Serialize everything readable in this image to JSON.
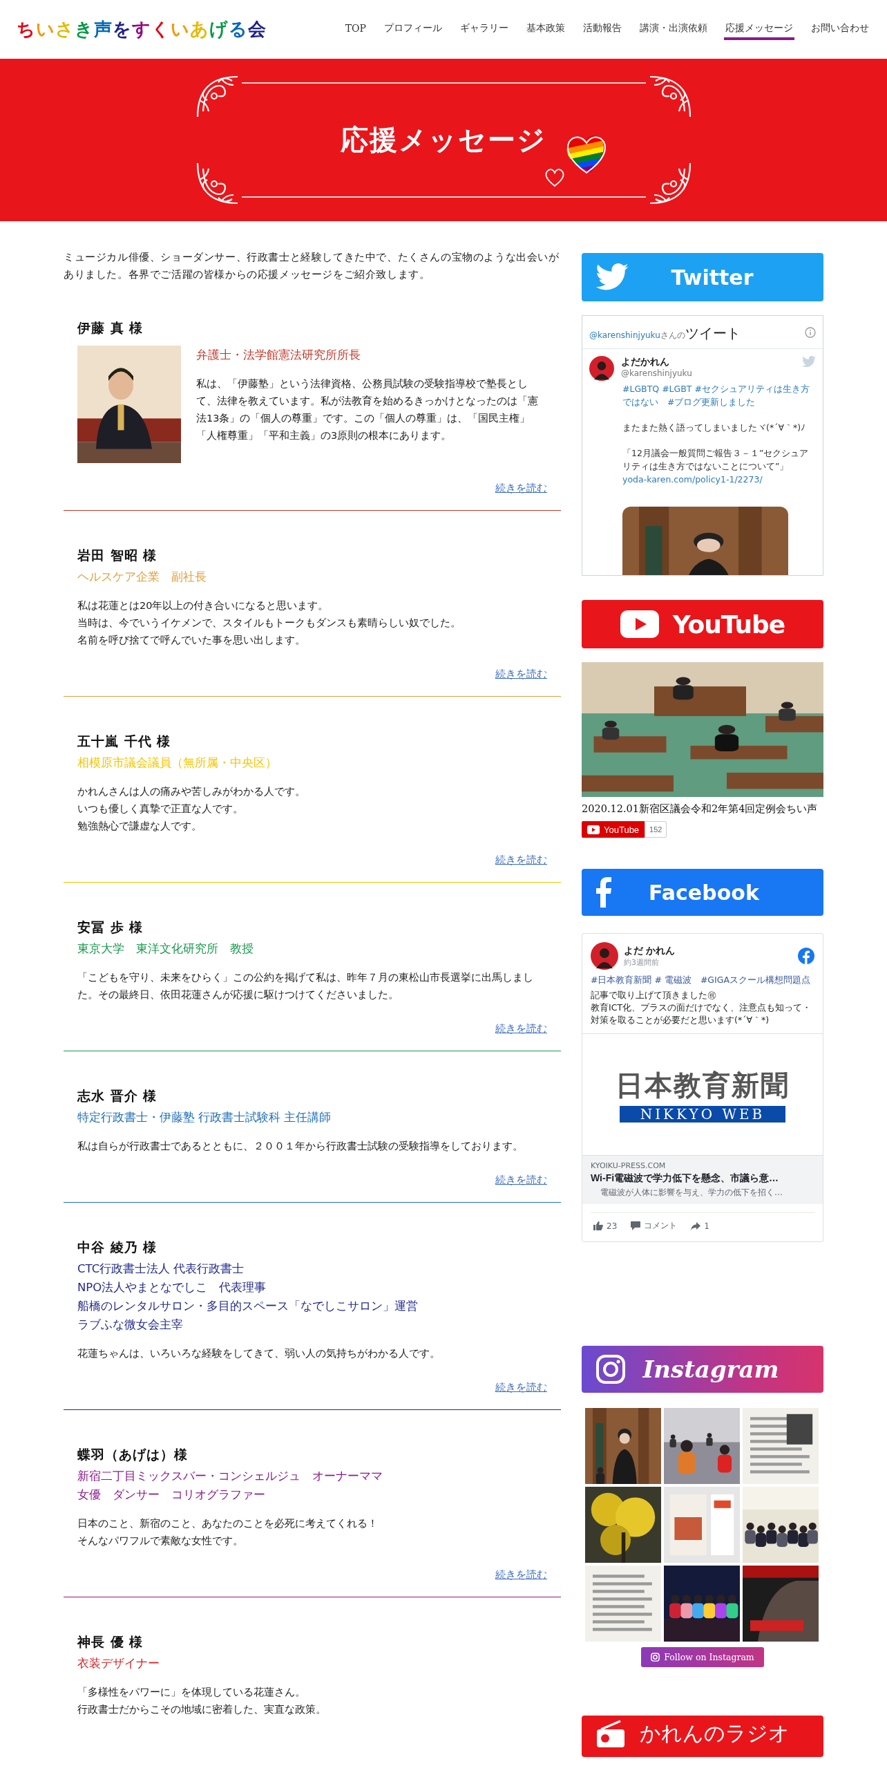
{
  "site_title": {
    "letters": [
      {
        "text": "ち",
        "color": "#e60012"
      },
      {
        "text": "い",
        "color": "#f39800"
      },
      {
        "text": "さ",
        "color": "#e6b800"
      },
      {
        "text": "き",
        "color": "#009944"
      },
      {
        "text": "声",
        "color": "#0068b7"
      },
      {
        "text": "を",
        "color": "#1d2088"
      },
      {
        "text": "す",
        "color": "#920783"
      },
      {
        "text": "く",
        "color": "#e60012"
      },
      {
        "text": "い",
        "color": "#f39800"
      },
      {
        "text": "あ",
        "color": "#e6b800"
      },
      {
        "text": "げ",
        "color": "#009944"
      },
      {
        "text": "る",
        "color": "#0068b7"
      },
      {
        "text": "会",
        "color": "#1d2088"
      }
    ]
  },
  "nav": [
    {
      "label": "TOP",
      "selected": false
    },
    {
      "label": "プロフィール",
      "selected": false
    },
    {
      "label": "ギャラリー",
      "selected": false
    },
    {
      "label": "基本政策",
      "selected": false
    },
    {
      "label": "活動報告",
      "selected": false
    },
    {
      "label": "講演・出演依頼",
      "selected": false
    },
    {
      "label": "応援メッセージ",
      "selected": true
    },
    {
      "label": "お問い合わせ",
      "selected": false
    }
  ],
  "hero": {
    "title": "応援メッセージ"
  },
  "intro": "ミュージカル俳優、ショーダンサー、行政書士と経験してきた中で、たくさんの宝物のような出会いがありました。各界でご活躍の皆様からの応援メッセージをご紹介致します。",
  "testimonials": [
    {
      "kind": "with_photo",
      "name": "伊藤 真 様",
      "color": "#c0392b",
      "titles": [
        "弁護士・法学館憲法研究所所長"
      ],
      "body": [
        "私は、「伊藤塾」という法律資格、公務員試験の受験指導校で塾長として、法律を教えています。私が法教育を始めるきっかけとなったのは「憲法13条」の「個人の尊重」です。この「個人の尊重」は、「国民主権」「人権尊重」「平和主義」の3原則の根本にあります。"
      ],
      "read_more": "続きを読む"
    },
    {
      "kind": "plain",
      "name": "岩田 智昭 様",
      "color": "#e0a040",
      "titles": [
        "ヘルスケア企業　副社長"
      ],
      "body": [
        "私は花蓮とは20年以上の付き合いになると思います。",
        "当時は、今でいうイケメンで、スタイルもトークもダンスも素晴らしい奴でした。",
        "名前を呼び捨てで呼んでいた事を思い出します。"
      ],
      "read_more": "続きを読む"
    },
    {
      "kind": "plain",
      "name": "五十嵐 千代 様",
      "color": "#f2c500",
      "titles": [
        "相模原市議会議員（無所属・中央区）"
      ],
      "body": [
        "かれんさんは人の痛みや苦しみがわかる人です。",
        "いつも優しく真摯で正直な人です。",
        "勉強熱心で謙虚な人です。"
      ],
      "read_more": "続きを読む"
    },
    {
      "kind": "plain",
      "name": "安冨 歩 様",
      "color": "#1a9a50",
      "titles": [
        "東京大学　東洋文化研究所　教授"
      ],
      "body": [
        "「こどもを守り、未来をひらく」この公約を掲げて私は、昨年７月の東松山市長選挙に出馬しました。その最終日、依田花蓮さんが応援に駆けつけてくださいました。"
      ],
      "read_more": "続きを読む"
    },
    {
      "kind": "plain",
      "name": "志水 晋介 様",
      "color": "#1f6fb5",
      "titles": [
        "特定行政書士・伊藤塾 行政書士試験科 主任講師"
      ],
      "body": [
        "私は自らが行政書士であるとともに、２００１年から行政書士試験の受験指導をしております。"
      ],
      "read_more": "続きを読む"
    },
    {
      "kind": "plain",
      "name": "中谷 綾乃 様",
      "color": "#232a8a",
      "titles": [
        "CTC行政書士法人 代表行政書士",
        "NPO法人やまとなでしこ　代表理事",
        "船橋のレンタルサロン・多目的スペース「なでしこサロン」運営",
        "ラブふな微女会主宰"
      ],
      "body": [
        "花蓮ちゃんは、いろいろな経験をしてきて、弱い人の気持ちがわかる人です。"
      ],
      "read_more": "続きを読む"
    },
    {
      "kind": "plain",
      "name": "蝶羽（あげは）様",
      "color": "#8b1a8b",
      "titles": [
        "新宿二丁目ミックスバー・コンシェルジュ　オーナーママ",
        "女優　ダンサー　コリオグラファー"
      ],
      "body": [
        "日本のこと、新宿のこと、あなたのことを必死に考えてくれる！",
        "そんなパワフルで素敵な女性です。"
      ],
      "read_more": "続きを読む"
    },
    {
      "kind": "plain",
      "name": "神長 優 様",
      "color": "#d42020",
      "titles": [
        "衣装デザイナー"
      ],
      "body": [
        "「多様性をパワーに」を体現している花蓮さん。",
        "行政書士だからこその地域に密着した、実直な政策。"
      ]
    }
  ],
  "twitter": {
    "banner": "Twitter",
    "handle_link": "@karenshinjyuku",
    "handle_suffix": "さんの",
    "heading": "ツイート",
    "author": "よだかれん",
    "author_handle": "@karenshinjyuku",
    "hashtags": "#LGBTQ #LGBT #セクシュアリティは生き方ではない　#ブログ更新しました",
    "paragraphs": [
      "またまた熱く語ってしまいましたヾ(*´∀｀*)ﾉ",
      "「12月議会一般質問ご報告３－１”セクシュアリティは生き方ではないことについて”」"
    ],
    "link": "yoda-karen.com/policy1-1/2273/"
  },
  "youtube": {
    "banner": "YouTube",
    "video_title": "2020.12.01新宿区議会令和2年第4回定例会ちい声",
    "subscribe": "YouTube",
    "subscriber_count": "152"
  },
  "facebook": {
    "banner": "Facebook",
    "author": "よだ かれん",
    "time": "約3週間前",
    "hashtags": "#日本教育新聞 # 電磁波　#GIGAスクール構想問題点",
    "paragraphs": [
      "記事で取り上げて頂きました㊗",
      "教育ICT化、プラスの面だけでなく、注意点も知って・対策を取ることが必要だと思います(*´∀｀*)"
    ],
    "logo_title": "日本教育新聞",
    "logo_subtitle": "NIKKYO WEB",
    "domain": "KYOIKU-PRESS.COM",
    "headline": "Wi-Fi電磁波で学力低下を懸念、市議ら意…",
    "description": "電磁波が人体に影響を与え、学力の低下を招く…",
    "likes": "23",
    "comment": "コメント",
    "shares": "1"
  },
  "instagram": {
    "banner": "Instagram",
    "follow": "Follow on Instagram"
  },
  "radio": {
    "banner": "かれんのラジオ"
  }
}
